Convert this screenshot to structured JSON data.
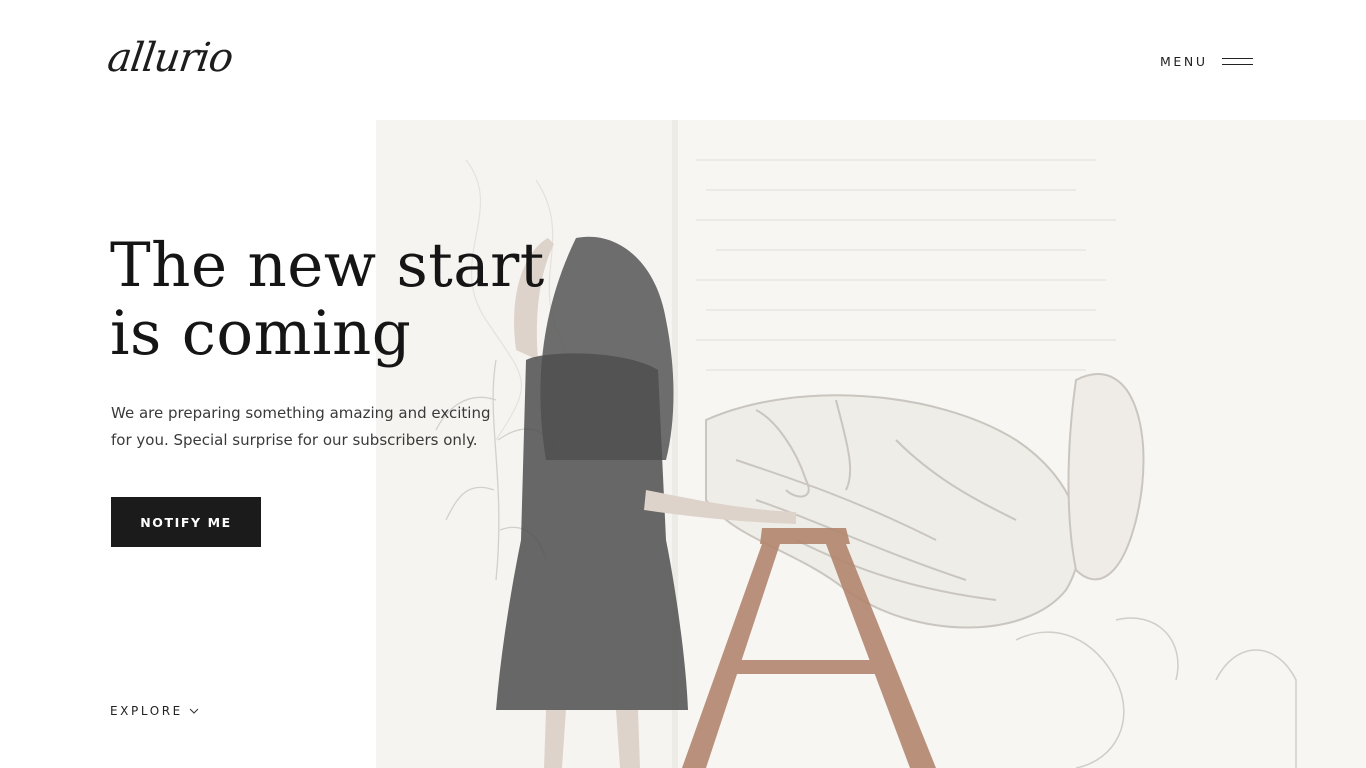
{
  "header": {
    "logo_text": "allurio",
    "menu_label": "MENU",
    "menu_icon": "hamburger-icon"
  },
  "hero": {
    "headline_line1": "The new start",
    "headline_line2": "is coming",
    "subtitle_line1": "We are preparing something amazing and exciting",
    "subtitle_line2": "for you. Special surprise for our subscribers only.",
    "cta_label": "NOTIFY ME",
    "image_description_icon": "hero-photo"
  },
  "footer": {
    "explore_label": "EXPLORE",
    "explore_icon": "chevron-down-icon"
  },
  "colors": {
    "text_dark": "#151515",
    "button_bg": "#1b1b1b",
    "button_text": "#ffffff",
    "image_wash": "#f3f1ec"
  }
}
